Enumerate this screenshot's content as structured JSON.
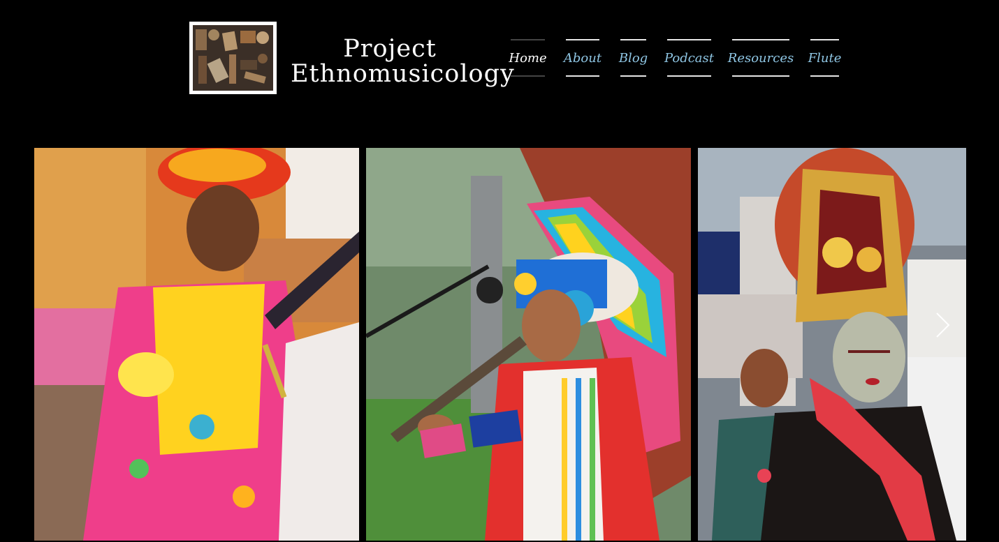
{
  "header": {
    "title_line1": "Project",
    "title_line2": "Ethnomusicology",
    "logo_icon": "instruments-collage-logo"
  },
  "nav": {
    "items": [
      {
        "label": "Home",
        "active": true
      },
      {
        "label": "About",
        "active": false
      },
      {
        "label": "Blog",
        "active": false
      },
      {
        "label": "Podcast",
        "active": false
      },
      {
        "label": "Resources",
        "active": false
      },
      {
        "label": "Flute",
        "active": false
      }
    ]
  },
  "gallery": {
    "slides": [
      {
        "subject": "musician-in-red-turban-playing-string-instrument"
      },
      {
        "subject": "musician-in-feathered-headdress-playing-flute"
      },
      {
        "subject": "performer-in-golden-crown-with-painted-face"
      }
    ],
    "next_icon": "chevron-right-icon"
  },
  "colors": {
    "background": "#000000",
    "nav_link": "#8fc6e4",
    "nav_active": "#ffffff",
    "title": "#ffffff"
  }
}
